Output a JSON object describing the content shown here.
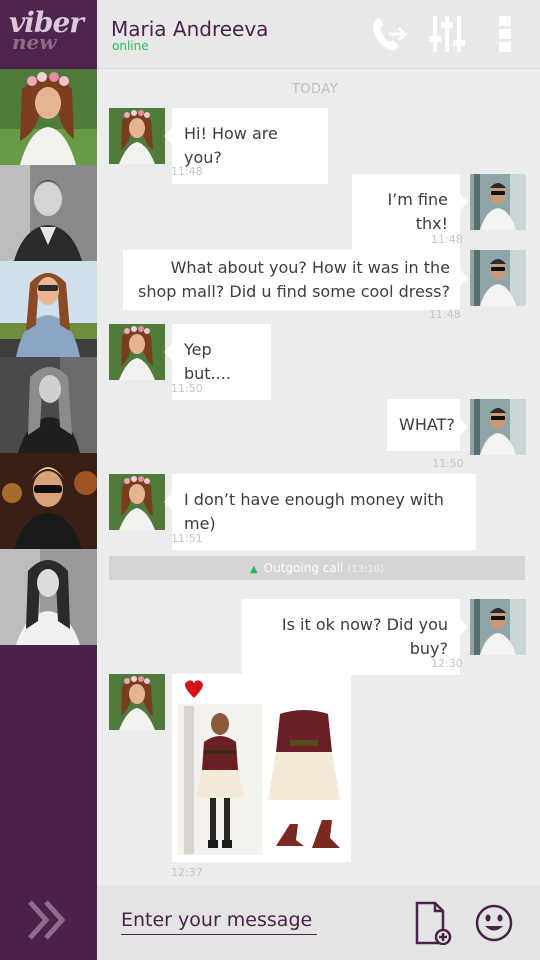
{
  "app": {
    "logo_line1": "viber",
    "logo_line2": "new"
  },
  "header": {
    "contact_name": "Maria Andreeva",
    "status": "online",
    "icons": [
      "call-out-icon",
      "equalizer-icon",
      "more-icon"
    ]
  },
  "sidebar": {
    "contacts": [
      "contact-1",
      "contact-2",
      "contact-3",
      "contact-4",
      "contact-5",
      "contact-6"
    ],
    "expand_icon": "double-chevron-right-icon"
  },
  "chat": {
    "day_label": "TODAY",
    "messages": [
      {
        "side": "left",
        "text": "Hi! How are you?",
        "time": "11:48"
      },
      {
        "side": "right",
        "text": "I’m fine thx!",
        "time": "11:48"
      },
      {
        "side": "right",
        "text": "What about you? How it was in the shop mall? Did u find some cool dress?",
        "time": "11:48"
      },
      {
        "side": "left",
        "text": "Yep but....",
        "time": "11:50"
      },
      {
        "side": "right",
        "text": "WHAT?",
        "time": "11:50"
      },
      {
        "side": "left",
        "text": "I don’t have enough money with me)",
        "time": "11:51"
      },
      {
        "side": "right",
        "text": "Is it ok now? Did you buy?",
        "time": "12:30"
      },
      {
        "side": "left",
        "type": "photo",
        "time": "12:37"
      }
    ],
    "call": {
      "label": "Outgoing call",
      "duration": "(13:10)"
    }
  },
  "footer": {
    "placeholder": "Enter your message",
    "icons": [
      "attach-file-icon",
      "emoji-icon"
    ]
  },
  "colors": {
    "brand": "#4a2249",
    "online": "#2db85b",
    "heart": "#d3121b"
  }
}
